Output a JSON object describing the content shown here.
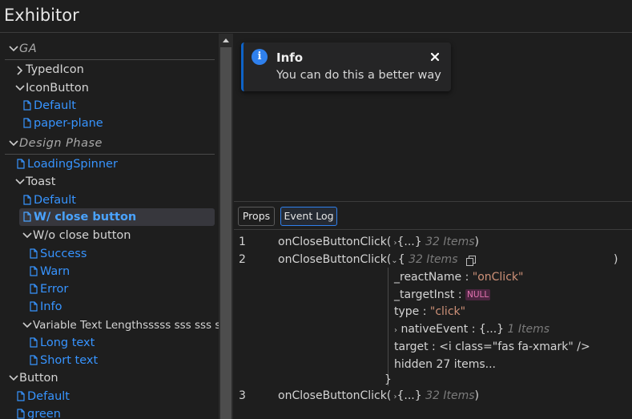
{
  "app": {
    "title": "Exhibitor"
  },
  "sidebar": {
    "groups": {
      "ga": "GA",
      "design": "Design Phase"
    },
    "items": {
      "typed_icon": "TypedIcon",
      "icon_button": "IconButton",
      "icon_button_default": "Default",
      "icon_button_paper_plane": "paper-plane",
      "loading_spinner": "LoadingSpinner",
      "toast": "Toast",
      "toast_default": "Default",
      "toast_close_button": "W/ close button",
      "toast_wo_close": "W/o close button",
      "success": "Success",
      "warn": "Warn",
      "error": "Error",
      "info": "Info",
      "variable_text": "Variable Text Lengthsssss sss sss sss",
      "long_text": "Long text",
      "short_text": "Short text",
      "button": "Button",
      "button_default": "Default",
      "button_green": "green"
    },
    "selected": "toast_close_button"
  },
  "preview": {
    "toast": {
      "icon": "info-icon",
      "icon_glyph": "i",
      "title": "Info",
      "message": "You can do this a better way",
      "accent": "#0e63c7"
    }
  },
  "panel": {
    "tabs": {
      "props": "Props",
      "event_log": "Event Log"
    },
    "active_tab": "Event Log"
  },
  "event_log": {
    "entries": [
      {
        "index": "1",
        "call": "onCloseButtonClick(",
        "summary": "{...}",
        "count": "32 Items",
        "close": ")"
      },
      {
        "index": "2",
        "call": "onCloseButtonClick(",
        "open": "{",
        "count": "32 Items",
        "close": ")"
      },
      {
        "index": "3",
        "call": "onCloseButtonClick(",
        "summary": "{...}",
        "count": "32 Items",
        "close": ")"
      }
    ],
    "expanded": {
      "react_name_key": "_reactName",
      "react_name_val": "\"onClick\"",
      "target_inst_key": "_targetInst",
      "target_inst_val": "NULL",
      "type_key": "type",
      "type_val": "\"click\"",
      "native_event_key": "nativeEvent",
      "native_event_val": "{...}",
      "native_event_count": "1 Items",
      "target_key": "target",
      "target_val": "<i class=\"fas fa-xmark\" />",
      "hidden": "hidden 27 items...",
      "close_brace": "}",
      "colon": ":"
    }
  }
}
